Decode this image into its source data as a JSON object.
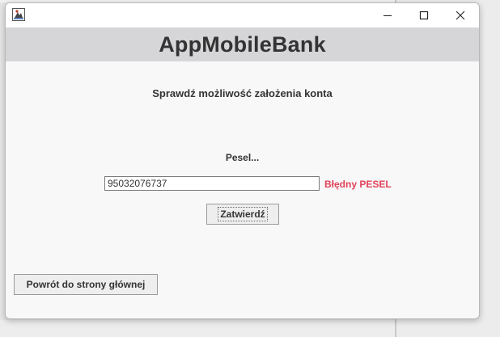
{
  "window": {
    "app_icon": "java-app-icon",
    "controls": {
      "minimize_icon": "minimize-icon",
      "maximize_icon": "maximize-icon",
      "close_icon": "close-icon"
    }
  },
  "header": {
    "title": "AppMobileBank"
  },
  "form": {
    "subtitle": "Sprawdź możliwość założenia konta",
    "pesel_label": "Pesel...",
    "pesel_value": "95032076737",
    "error_message": "Błędny PESEL",
    "error_color": "#e0435a",
    "submit_label": "Zatwierdź"
  },
  "footer": {
    "back_label": "Powrót do strony głównej"
  }
}
